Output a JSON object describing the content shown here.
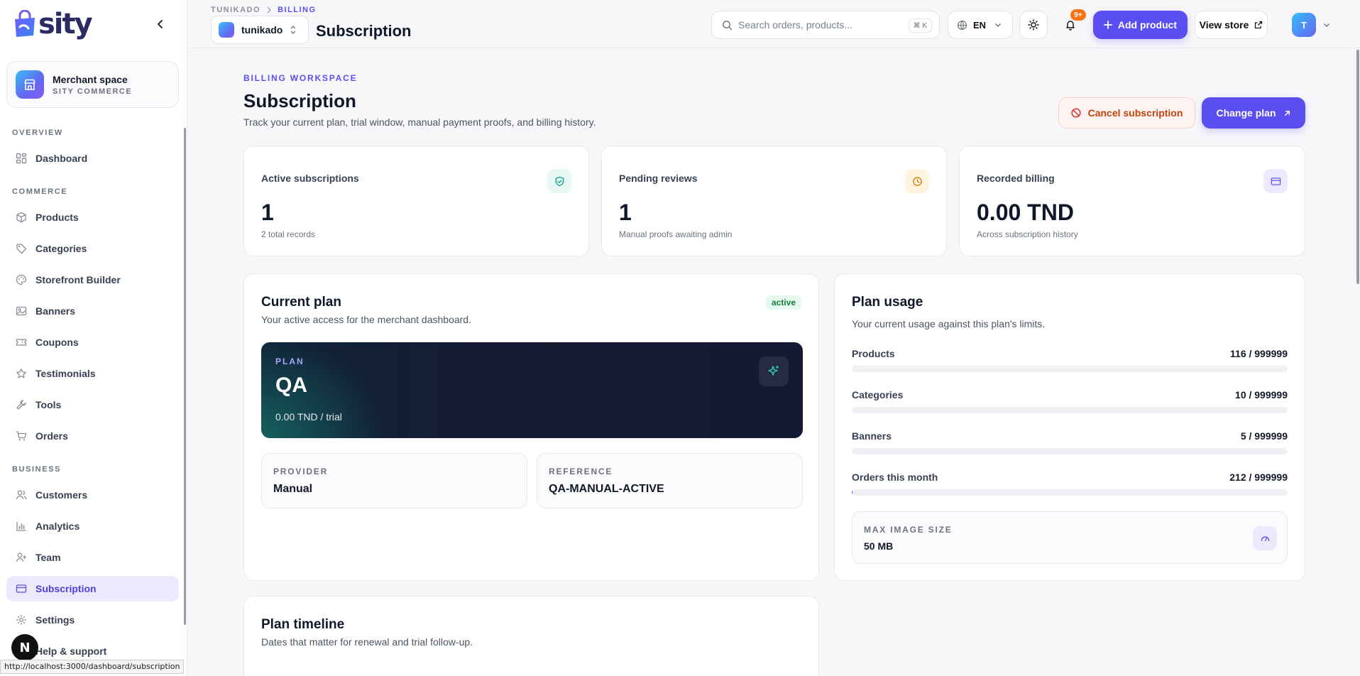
{
  "sidebar": {
    "brand": "sity",
    "merchant": {
      "name": "Merchant space",
      "subtitle": "SITY COMMERCE"
    },
    "sections": {
      "overview": "OVERVIEW",
      "commerce": "COMMERCE",
      "business": "BUSINESS"
    },
    "items": {
      "dashboard": "Dashboard",
      "products": "Products",
      "categories": "Categories",
      "storefront": "Storefront Builder",
      "banners": "Banners",
      "coupons": "Coupons",
      "testimonials": "Testimonials",
      "tools": "Tools",
      "orders": "Orders",
      "customers": "Customers",
      "analytics": "Analytics",
      "team": "Team",
      "subscription": "Subscription",
      "settings": "Settings",
      "help": "Help & support"
    },
    "active_item": "subscription",
    "dev_badge": "N",
    "status_url": "http://localhost:3000/dashboard/subscription"
  },
  "topbar": {
    "breadcrumb": {
      "root": "TUNIKADO",
      "current": "BILLING"
    },
    "store_name": "tunikado",
    "title": "Subscription",
    "search_placeholder": "Search orders, products...",
    "search_shortcut": "⌘ K",
    "language": "EN",
    "notification_count": "9+",
    "add_product_label": "Add product",
    "view_store_label": "View store",
    "avatar_initial": "T"
  },
  "header": {
    "eyebrow": "BILLING WORKSPACE",
    "title": "Subscription",
    "description": "Track your current plan, trial window, manual payment proofs, and billing history.",
    "cancel_label": "Cancel subscription",
    "change_label": "Change plan"
  },
  "stats": [
    {
      "label": "Active subscriptions",
      "value": "1",
      "sub": "2 total records",
      "icon": "shield-check-icon",
      "color": "#0f9f8f",
      "bg": "#e7f7f3"
    },
    {
      "label": "Pending reviews",
      "value": "1",
      "sub": "Manual proofs awaiting admin",
      "icon": "clock-icon",
      "color": "#d97706",
      "bg": "#fff4e0"
    },
    {
      "label": "Recorded billing",
      "value": "0.00 TND",
      "sub": "Across subscription history",
      "icon": "credit-card-icon",
      "color": "#5b4ef0",
      "bg": "#ece9ff"
    }
  ],
  "current_plan": {
    "title": "Current plan",
    "subtitle": "Your active access for the merchant dashboard.",
    "status": "active",
    "plan_eyebrow": "PLAN",
    "plan_name": "QA",
    "price": "0.00 TND / trial",
    "provider_label": "PROVIDER",
    "provider_value": "Manual",
    "reference_label": "REFERENCE",
    "reference_value": "QA-MANUAL-ACTIVE"
  },
  "plan_usage": {
    "title": "Plan usage",
    "subtitle": "Your current usage against this plan's limits.",
    "rows": [
      {
        "name": "Products",
        "value": "116 / 999999",
        "fraction": 0.000116
      },
      {
        "name": "Categories",
        "value": "10 / 999999",
        "fraction": 1e-05
      },
      {
        "name": "Banners",
        "value": "5 / 999999",
        "fraction": 5e-06
      },
      {
        "name": "Orders this month",
        "value": "212 / 999999",
        "fraction": 0.000212
      }
    ],
    "max_image_label": "MAX IMAGE SIZE",
    "max_image_value": "50 MB"
  },
  "timeline": {
    "title": "Plan timeline",
    "subtitle": "Dates that matter for renewal and trial follow-up."
  },
  "colors": {
    "accent": "#5b4ef0",
    "danger": "#c2410c",
    "success": "#15803d"
  }
}
